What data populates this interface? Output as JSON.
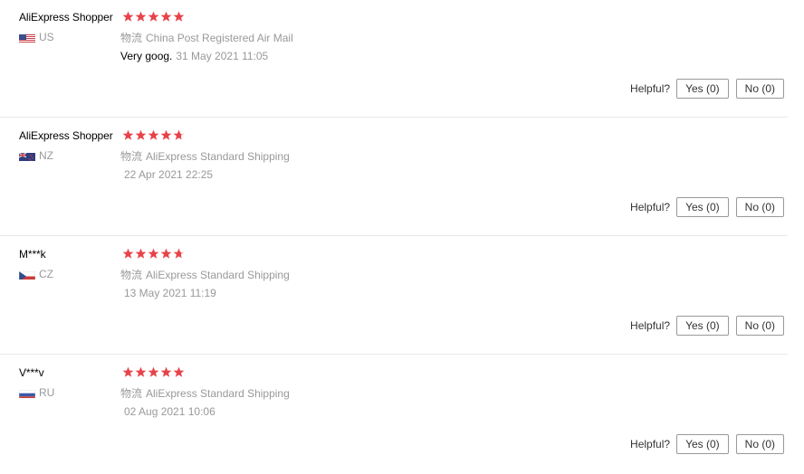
{
  "colors": {
    "star": "#e8424a",
    "muted": "#999999",
    "divider": "#e8e8e8"
  },
  "helpful_label": "Helpful?",
  "shipping_label": "物流",
  "reviews": [
    {
      "name": "AliExpress Shopper",
      "country_code": "US",
      "flag_icon": "us-flag-icon",
      "rating": 5,
      "shipping_method": "China Post Registered Air Mail",
      "text": "Very goog.",
      "date": "31 May 2021 11:05",
      "yes_label": "Yes (0)",
      "no_label": "No (0)"
    },
    {
      "name": "AliExpress Shopper",
      "country_code": "NZ",
      "flag_icon": "nz-flag-icon",
      "rating": 4.5,
      "shipping_method": "AliExpress Standard Shipping",
      "text": "",
      "date": "22 Apr 2021 22:25",
      "yes_label": "Yes (0)",
      "no_label": "No (0)"
    },
    {
      "name": "M***k",
      "country_code": "CZ",
      "flag_icon": "cz-flag-icon",
      "rating": 4.5,
      "shipping_method": "AliExpress Standard Shipping",
      "text": "",
      "date": "13 May 2021 11:19",
      "yes_label": "Yes (0)",
      "no_label": "No (0)"
    },
    {
      "name": "V***v",
      "country_code": "RU",
      "flag_icon": "ru-flag-icon",
      "rating": 5,
      "shipping_method": "AliExpress Standard Shipping",
      "text": "",
      "date": "02 Aug 2021 10:06",
      "yes_label": "Yes (0)",
      "no_label": "No (0)"
    }
  ]
}
